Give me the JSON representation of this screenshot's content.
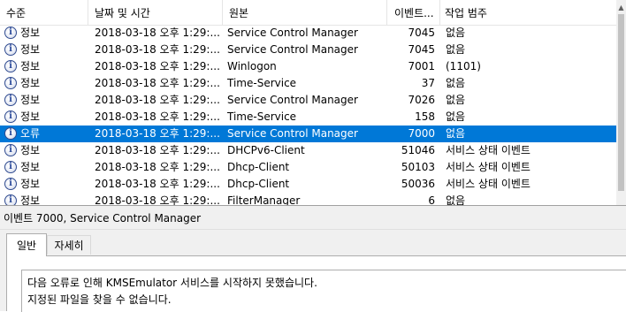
{
  "table": {
    "headers": {
      "level": "수준",
      "date": "날짜 및 시간",
      "source": "원본",
      "event_id": "이벤트...",
      "category": "작업 범주"
    },
    "rows": [
      {
        "level": "정보",
        "date": "2018-03-18 오후 1:29:...",
        "source": "Service Control Manager",
        "event_id": "7045",
        "category": "없음",
        "selected": false
      },
      {
        "level": "정보",
        "date": "2018-03-18 오후 1:29:...",
        "source": "Service Control Manager",
        "event_id": "7045",
        "category": "없음",
        "selected": false
      },
      {
        "level": "정보",
        "date": "2018-03-18 오후 1:29:...",
        "source": "Winlogon",
        "event_id": "7001",
        "category": "(1101)",
        "selected": false
      },
      {
        "level": "정보",
        "date": "2018-03-18 오후 1:29:...",
        "source": "Time-Service",
        "event_id": "37",
        "category": "없음",
        "selected": false
      },
      {
        "level": "정보",
        "date": "2018-03-18 오후 1:29:...",
        "source": "Service Control Manager",
        "event_id": "7026",
        "category": "없음",
        "selected": false
      },
      {
        "level": "정보",
        "date": "2018-03-18 오후 1:29:...",
        "source": "Time-Service",
        "event_id": "158",
        "category": "없음",
        "selected": false
      },
      {
        "level": "오류",
        "date": "2018-03-18 오후 1:29:...",
        "source": "Service Control Manager",
        "event_id": "7000",
        "category": "없음",
        "selected": true
      },
      {
        "level": "정보",
        "date": "2018-03-18 오후 1:29:...",
        "source": "DHCPv6-Client",
        "event_id": "51046",
        "category": "서비스 상태 이벤트",
        "selected": false
      },
      {
        "level": "정보",
        "date": "2018-03-18 오후 1:29:...",
        "source": "Dhcp-Client",
        "event_id": "50103",
        "category": "서비스 상태 이벤트",
        "selected": false
      },
      {
        "level": "정보",
        "date": "2018-03-18 오후 1:29:...",
        "source": "Dhcp-Client",
        "event_id": "50036",
        "category": "서비스 상태 이벤트",
        "selected": false
      },
      {
        "level": "정보",
        "date": "2018-03-18 오후 1:29:...",
        "source": "FilterManager",
        "event_id": "6",
        "category": "없음",
        "selected": false
      }
    ]
  },
  "detail": {
    "title": "이벤트 7000, Service Control Manager",
    "tabs": [
      "일반",
      "자세히"
    ],
    "message_lines": [
      "다음 오류로 인해 KMSEmulator 서비스를 시작하지 못했습니다.",
      "지정된 파일을 찾을 수 없습니다."
    ]
  },
  "colors": {
    "selection": "#0078d7",
    "info_icon_border": "#2f4a8f"
  },
  "icons": {
    "info": "info-circle-icon",
    "error_row_icon": "info-circle-icon"
  }
}
